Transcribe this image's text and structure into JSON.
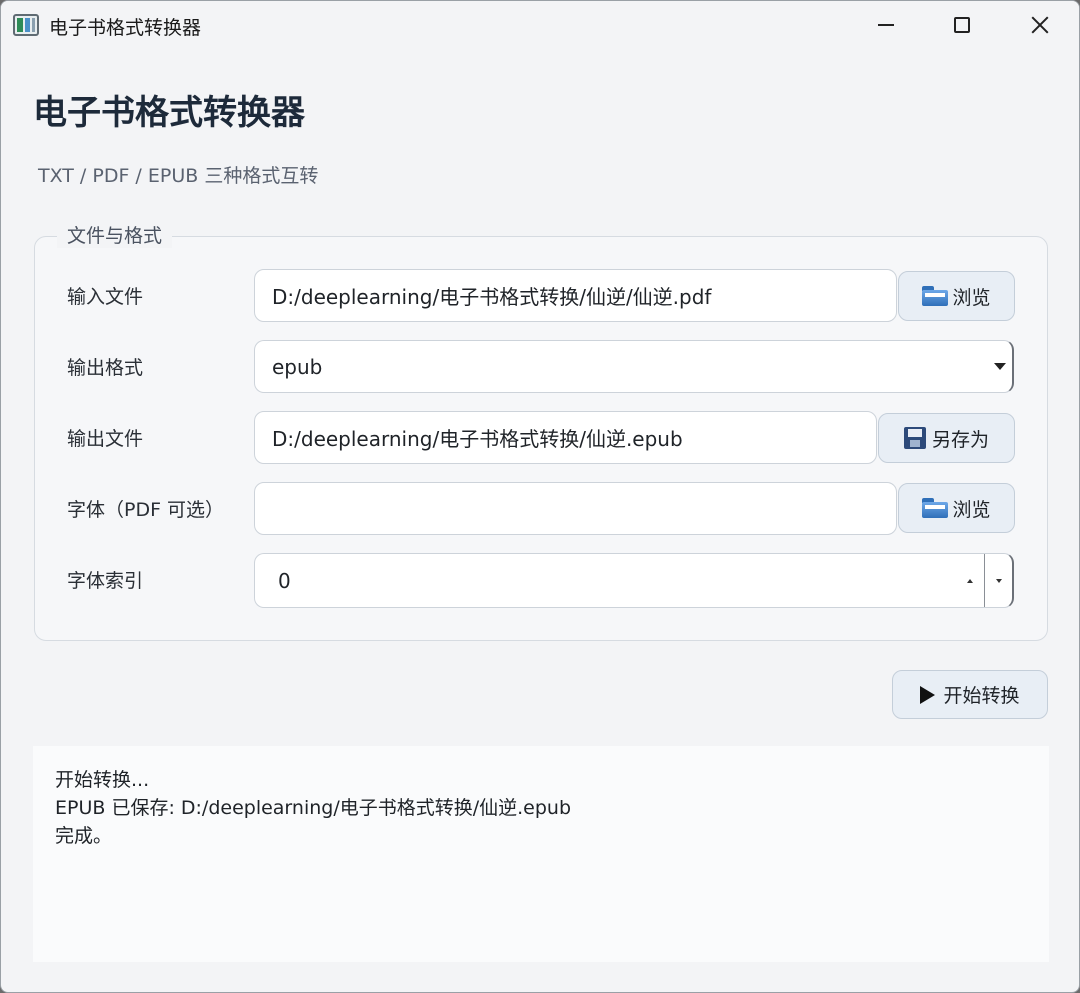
{
  "window": {
    "title": "电子书格式转换器"
  },
  "header": {
    "title": "电子书格式转换器",
    "subtitle": "TXT / PDF / EPUB 三种格式互转"
  },
  "group": {
    "title": "文件与格式",
    "rows": {
      "input_file": {
        "label": "输入文件",
        "value": "D:/deeplearning/电子书格式转换/仙逆/仙逆.pdf",
        "button_label": "浏览",
        "button_icon": "folder-icon"
      },
      "output_format": {
        "label": "输出格式",
        "value": "epub"
      },
      "output_file": {
        "label": "输出文件",
        "value": "D:/deeplearning/电子书格式转换/仙逆.epub",
        "button_label": "另存为",
        "button_icon": "floppy-disk-icon"
      },
      "font": {
        "label": "字体（PDF 可选）",
        "value": "",
        "button_label": "浏览",
        "button_icon": "folder-icon"
      },
      "font_index": {
        "label": "字体索引",
        "value": "0"
      }
    }
  },
  "actions": {
    "start_label": "开始转换",
    "start_icon": "play-icon"
  },
  "log": {
    "lines": [
      "开始转换...",
      "EPUB 已保存: D:/deeplearning/电子书格式转换/仙逆.epub",
      "完成。"
    ]
  },
  "colors": {
    "window_bg": "#f3f4f6",
    "button_bg": "#e8eef5",
    "heading": "#1d2a3a"
  }
}
